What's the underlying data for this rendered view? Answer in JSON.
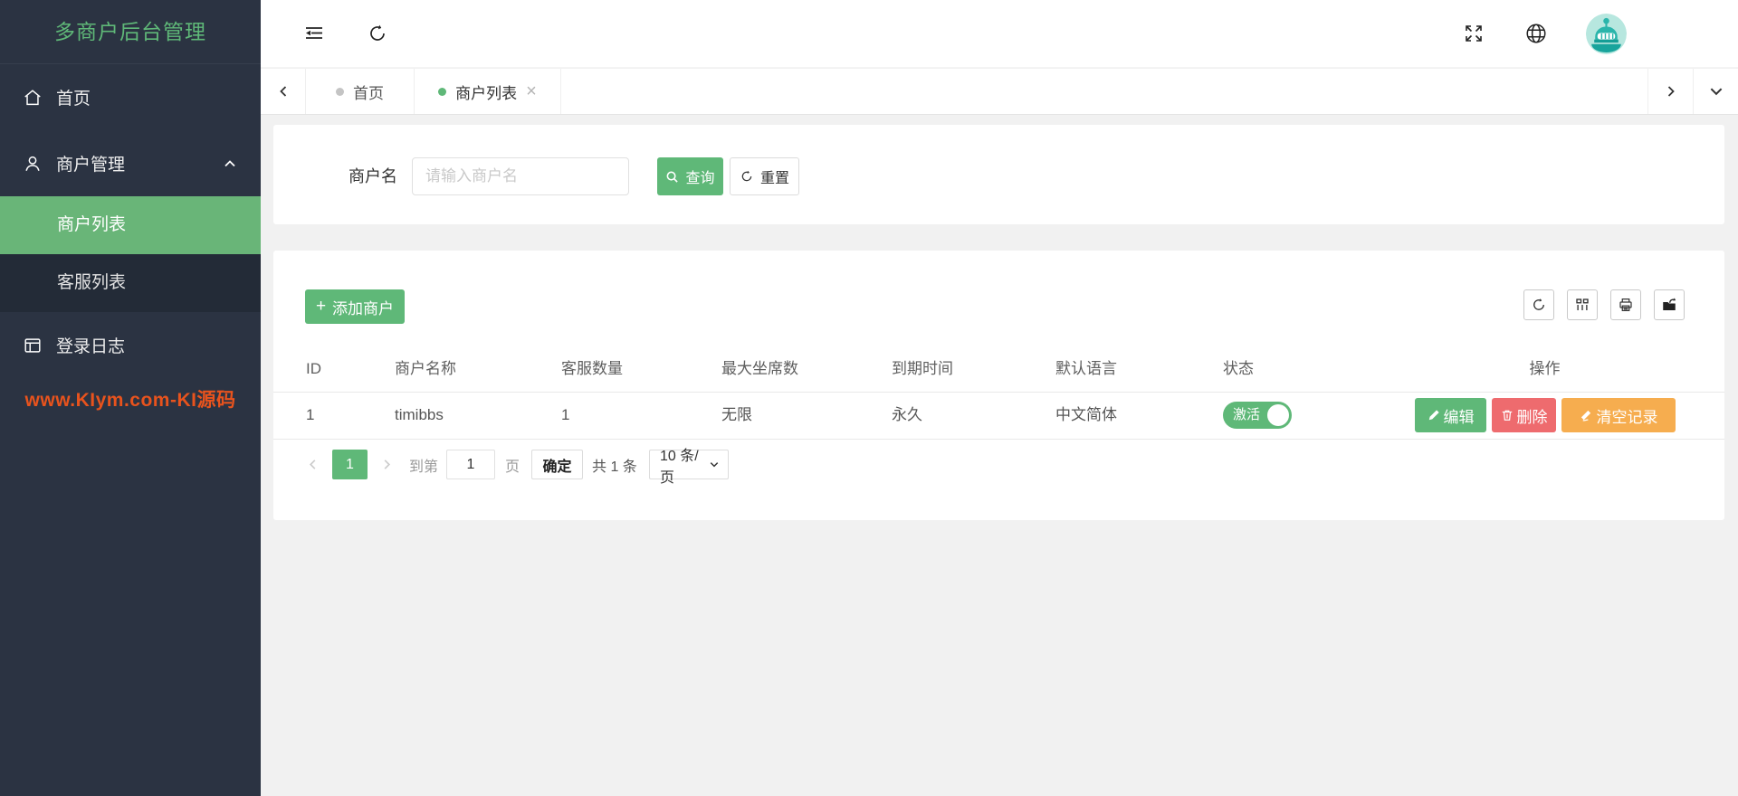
{
  "colors": {
    "accent_green": "#5fb878",
    "sidebar_bg": "#2b3342",
    "sidebar_submenu_bg": "#232b37",
    "sidebar_active_bg": "#69b578",
    "delete_red": "#ee6b6e",
    "clear_orange": "#f6ad4f",
    "watermark_orange": "#e8531d",
    "avatar_teal": "#2ab5ab"
  },
  "icons": {
    "close": "×",
    "plus": "+"
  },
  "sidebar": {
    "title": "多商户后台管理",
    "items": [
      {
        "label": "首页",
        "icon": "home-icon"
      },
      {
        "label": "商户管理",
        "icon": "user-icon",
        "expanded": true
      },
      {
        "label": "登录日志",
        "icon": "log-icon"
      }
    ],
    "submenu": [
      {
        "label": "商户列表",
        "active": true
      },
      {
        "label": "客服列表",
        "active": false
      }
    ],
    "watermark": "www.KIym.com-KI源码"
  },
  "topbar": {
    "icons": [
      "collapse-menu-icon",
      "refresh-icon",
      "fullscreen-icon",
      "globe-icon",
      "avatar"
    ]
  },
  "tabs": {
    "items": [
      {
        "label": "首页",
        "active": false
      },
      {
        "label": "商户列表",
        "active": true,
        "closable": true
      }
    ]
  },
  "search": {
    "label": "商户名",
    "placeholder": "请输入商户名",
    "query_label": "查询",
    "reset_label": "重置"
  },
  "table_card": {
    "add_button_label": "添加商户",
    "toolbar_icons": [
      "refresh-icon",
      "columns-icon",
      "print-icon",
      "export-icon"
    ]
  },
  "table": {
    "columns": [
      "ID",
      "商户名称",
      "客服数量",
      "最大坐席数",
      "到期时间",
      "默认语言",
      "状态",
      "操作"
    ],
    "rows": [
      {
        "id": "1",
        "name": "timibbs",
        "agents": "1",
        "max_seats": "无限",
        "expire": "永久",
        "language": "中文简体",
        "status": "激活",
        "status_on": true
      }
    ]
  },
  "actions": {
    "edit": "编辑",
    "delete": "删除",
    "clear": "清空记录"
  },
  "pagination": {
    "current_page": "1",
    "goto_label": "到第",
    "page_input_value": "1",
    "page_label": "页",
    "confirm_label": "确定",
    "total_label": "共 1 条",
    "per_page_selected": "10 条/页"
  }
}
